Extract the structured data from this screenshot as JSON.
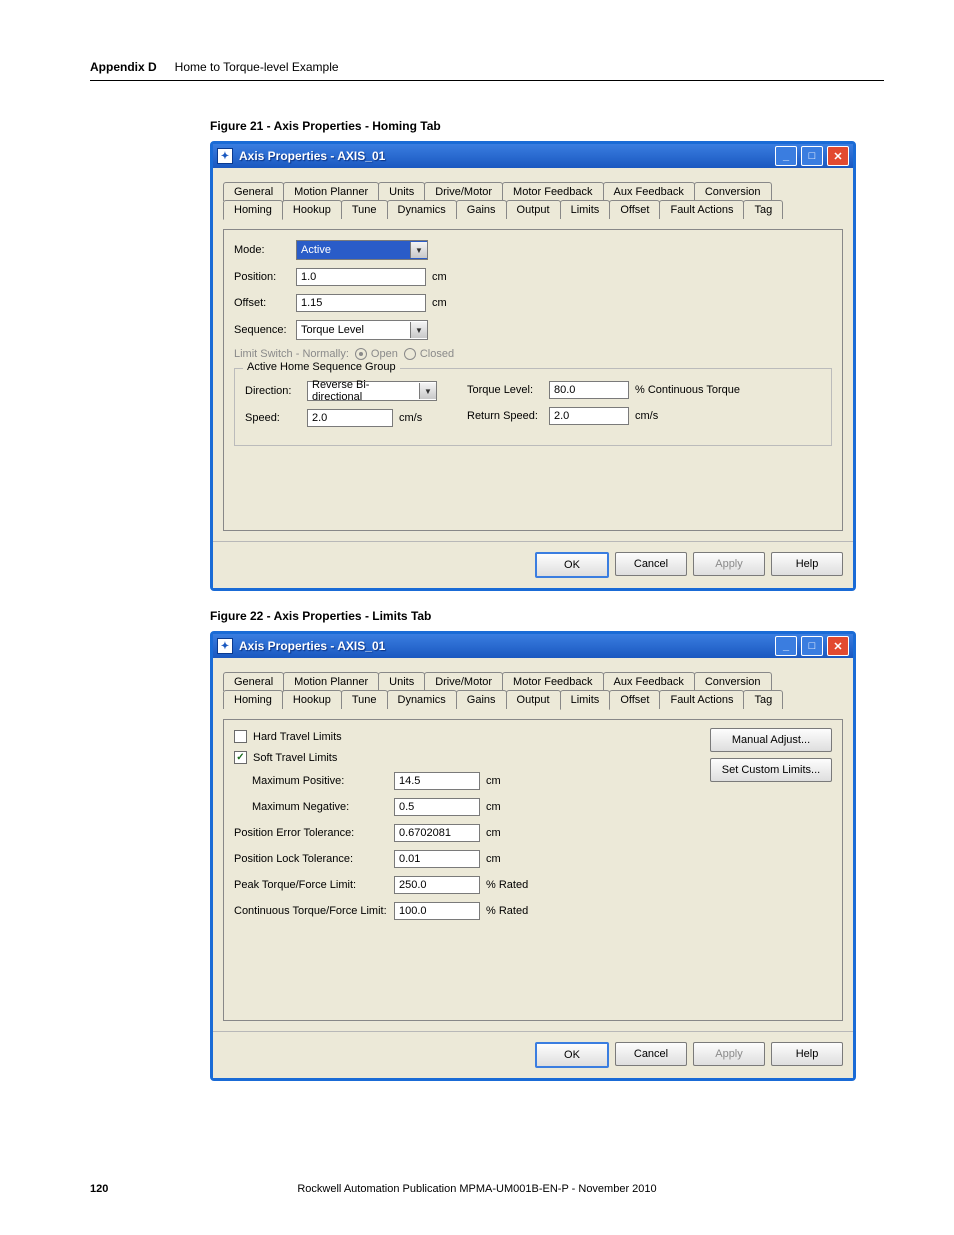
{
  "header": {
    "appendix": "Appendix D",
    "subtitle": "Home to Torque-level Example"
  },
  "fig1": {
    "caption": "Figure 21 - Axis Properties - Homing Tab",
    "title": "Axis Properties - AXIS_01",
    "tabs_row1": [
      "General",
      "Motion Planner",
      "Units",
      "Drive/Motor",
      "Motor Feedback",
      "Aux Feedback",
      "Conversion"
    ],
    "tabs_row2": [
      "Homing",
      "Hookup",
      "Tune",
      "Dynamics",
      "Gains",
      "Output",
      "Limits",
      "Offset",
      "Fault Actions",
      "Tag"
    ],
    "active": "Homing",
    "mode": {
      "label": "Mode:",
      "value": "Active"
    },
    "position": {
      "label": "Position:",
      "value": "1.0",
      "unit": "cm"
    },
    "offset": {
      "label": "Offset:",
      "value": "1.15",
      "unit": "cm"
    },
    "sequence": {
      "label": "Sequence:",
      "value": "Torque Level"
    },
    "limitSwitch": {
      "label": "Limit Switch - Normally:",
      "opt1": "Open",
      "opt2": "Closed"
    },
    "group": {
      "title": "Active Home Sequence Group",
      "direction": {
        "label": "Direction:",
        "value": "Reverse Bi-directional"
      },
      "speed": {
        "label": "Speed:",
        "value": "2.0",
        "unit": "cm/s"
      },
      "torque": {
        "label": "Torque Level:",
        "value": "80.0",
        "unit": "% Continuous Torque"
      },
      "ret": {
        "label": "Return Speed:",
        "value": "2.0",
        "unit": "cm/s"
      }
    },
    "buttons": {
      "ok": "OK",
      "cancel": "Cancel",
      "apply": "Apply",
      "help": "Help"
    }
  },
  "fig2": {
    "caption": "Figure 22 - Axis Properties - Limits Tab",
    "title": "Axis Properties - AXIS_01",
    "tabs_row1": [
      "General",
      "Motion Planner",
      "Units",
      "Drive/Motor",
      "Motor Feedback",
      "Aux Feedback",
      "Conversion"
    ],
    "tabs_row2": [
      "Homing",
      "Hookup",
      "Tune",
      "Dynamics",
      "Gains",
      "Output",
      "Limits",
      "Offset",
      "Fault Actions",
      "Tag"
    ],
    "active": "Limits",
    "hard": {
      "label": "Hard Travel Limits",
      "checked": false
    },
    "soft": {
      "label": "Soft Travel Limits",
      "checked": true
    },
    "rbuttons": {
      "manual": "Manual Adjust...",
      "custom": "Set Custom Limits..."
    },
    "rows": [
      {
        "label": "Maximum Positive:",
        "value": "14.5",
        "unit": "cm",
        "indent": true
      },
      {
        "label": "Maximum Negative:",
        "value": "0.5",
        "unit": "cm",
        "indent": true
      },
      {
        "label": "Position Error Tolerance:",
        "value": "0.6702081",
        "unit": "cm"
      },
      {
        "label": "Position Lock Tolerance:",
        "value": "0.01",
        "unit": "cm"
      },
      {
        "label": "Peak Torque/Force Limit:",
        "value": "250.0",
        "unit": "% Rated"
      },
      {
        "label": "Continuous Torque/Force Limit:",
        "value": "100.0",
        "unit": "% Rated"
      }
    ],
    "buttons": {
      "ok": "OK",
      "cancel": "Cancel",
      "apply": "Apply",
      "help": "Help"
    }
  },
  "footer": {
    "page": "120",
    "pub": "Rockwell Automation Publication MPMA-UM001B-EN-P - November 2010"
  }
}
